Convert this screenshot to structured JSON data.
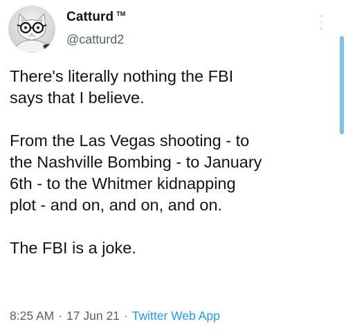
{
  "author": {
    "display_name": "Catturd",
    "trademark": "TM",
    "handle": "@catturd2",
    "avatar_icon": "cat-with-glasses-avatar-icon"
  },
  "tweet": {
    "text": "There's literally nothing the FBI\nsays that I believe.\n\nFrom the Las Vegas shooting - to\nthe Nashville Bombing - to January\n6th - to the Whitmer kidnapping\nplot - and on, and on, and on.\n\nThe FBI is a joke."
  },
  "meta": {
    "time": "8:25 AM",
    "separator": "·",
    "date": "17 Jun 21",
    "source": "Twitter Web App"
  },
  "colors": {
    "text": "#0f1419",
    "muted": "#536471",
    "link": "#1d9bf0",
    "scroll": "#7dc1ea"
  },
  "icons": {
    "more": "more-vertical-icon"
  }
}
